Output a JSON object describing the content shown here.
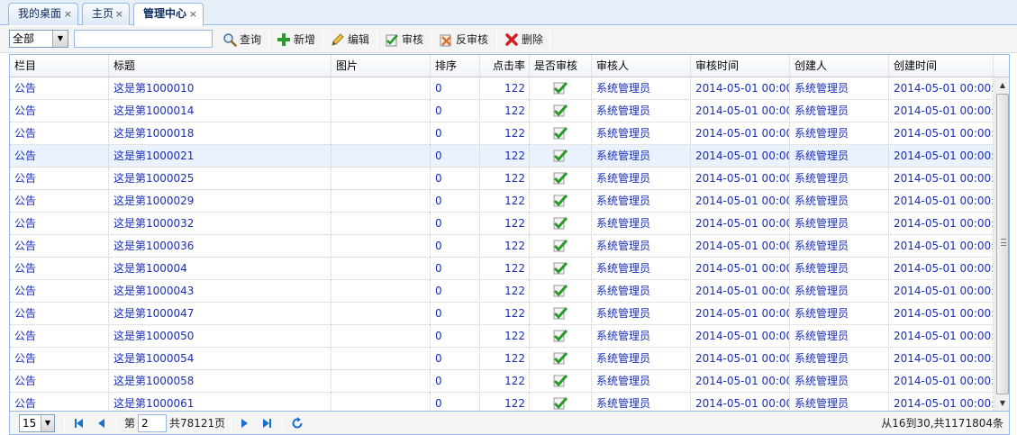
{
  "tabs": [
    {
      "label": "我的桌面",
      "close": "×"
    },
    {
      "label": "主页",
      "close": "×"
    },
    {
      "label": "管理中心",
      "close": "×"
    }
  ],
  "toolbar": {
    "filter_value": "全部",
    "search_value": "",
    "query_label": "查询",
    "add_label": "新增",
    "edit_label": "编辑",
    "audit_label": "审核",
    "unaudit_label": "反审核",
    "delete_label": "删除"
  },
  "grid": {
    "columns": [
      "栏目",
      "标题",
      "图片",
      "排序",
      "点击率",
      "是否审核",
      "审核人",
      "审核时间",
      "创建人",
      "创建时间"
    ],
    "rows": [
      {
        "category": "公告",
        "title": "这是第1000010",
        "image": "",
        "sort": "0",
        "clicks": "122",
        "audited": true,
        "auditor": "系统管理员",
        "audit_time": "2014-05-01 00:00:",
        "creator": "系统管理员",
        "created": "2014-05-01 00:00:0"
      },
      {
        "category": "公告",
        "title": "这是第1000014",
        "image": "",
        "sort": "0",
        "clicks": "122",
        "audited": true,
        "auditor": "系统管理员",
        "audit_time": "2014-05-01 00:00:",
        "creator": "系统管理员",
        "created": "2014-05-01 00:00:0"
      },
      {
        "category": "公告",
        "title": "这是第1000018",
        "image": "",
        "sort": "0",
        "clicks": "122",
        "audited": true,
        "auditor": "系统管理员",
        "audit_time": "2014-05-01 00:00:",
        "creator": "系统管理员",
        "created": "2014-05-01 00:00:0"
      },
      {
        "category": "公告",
        "title": "这是第1000021",
        "image": "",
        "sort": "0",
        "clicks": "122",
        "audited": true,
        "auditor": "系统管理员",
        "audit_time": "2014-05-01 00:00:",
        "creator": "系统管理员",
        "created": "2014-05-01 00:00:0"
      },
      {
        "category": "公告",
        "title": "这是第1000025",
        "image": "",
        "sort": "0",
        "clicks": "122",
        "audited": true,
        "auditor": "系统管理员",
        "audit_time": "2014-05-01 00:00:",
        "creator": "系统管理员",
        "created": "2014-05-01 00:00:0"
      },
      {
        "category": "公告",
        "title": "这是第1000029",
        "image": "",
        "sort": "0",
        "clicks": "122",
        "audited": true,
        "auditor": "系统管理员",
        "audit_time": "2014-05-01 00:00:",
        "creator": "系统管理员",
        "created": "2014-05-01 00:00:0"
      },
      {
        "category": "公告",
        "title": "这是第1000032",
        "image": "",
        "sort": "0",
        "clicks": "122",
        "audited": true,
        "auditor": "系统管理员",
        "audit_time": "2014-05-01 00:00:",
        "creator": "系统管理员",
        "created": "2014-05-01 00:00:0"
      },
      {
        "category": "公告",
        "title": "这是第1000036",
        "image": "",
        "sort": "0",
        "clicks": "122",
        "audited": true,
        "auditor": "系统管理员",
        "audit_time": "2014-05-01 00:00:",
        "creator": "系统管理员",
        "created": "2014-05-01 00:00:0"
      },
      {
        "category": "公告",
        "title": "这是第100004",
        "image": "",
        "sort": "0",
        "clicks": "122",
        "audited": true,
        "auditor": "系统管理员",
        "audit_time": "2014-05-01 00:00:",
        "creator": "系统管理员",
        "created": "2014-05-01 00:00:0"
      },
      {
        "category": "公告",
        "title": "这是第1000043",
        "image": "",
        "sort": "0",
        "clicks": "122",
        "audited": true,
        "auditor": "系统管理员",
        "audit_time": "2014-05-01 00:00:",
        "creator": "系统管理员",
        "created": "2014-05-01 00:00:0"
      },
      {
        "category": "公告",
        "title": "这是第1000047",
        "image": "",
        "sort": "0",
        "clicks": "122",
        "audited": true,
        "auditor": "系统管理员",
        "audit_time": "2014-05-01 00:00:",
        "creator": "系统管理员",
        "created": "2014-05-01 00:00:0"
      },
      {
        "category": "公告",
        "title": "这是第1000050",
        "image": "",
        "sort": "0",
        "clicks": "122",
        "audited": true,
        "auditor": "系统管理员",
        "audit_time": "2014-05-01 00:00:",
        "creator": "系统管理员",
        "created": "2014-05-01 00:00:0"
      },
      {
        "category": "公告",
        "title": "这是第1000054",
        "image": "",
        "sort": "0",
        "clicks": "122",
        "audited": true,
        "auditor": "系统管理员",
        "audit_time": "2014-05-01 00:00:",
        "creator": "系统管理员",
        "created": "2014-05-01 00:00:0"
      },
      {
        "category": "公告",
        "title": "这是第1000058",
        "image": "",
        "sort": "0",
        "clicks": "122",
        "audited": true,
        "auditor": "系统管理员",
        "audit_time": "2014-05-01 00:00:",
        "creator": "系统管理员",
        "created": "2014-05-01 00:00:0"
      },
      {
        "category": "公告",
        "title": "这是第1000061",
        "image": "",
        "sort": "0",
        "clicks": "122",
        "audited": true,
        "auditor": "系统管理员",
        "audit_time": "2014-05-01 00:00:",
        "creator": "系统管理员",
        "created": "2014-05-01 00:00:0"
      }
    ],
    "highlighted_row": 3
  },
  "pager": {
    "page_size": "15",
    "page_prefix": "第",
    "current_page": "2",
    "page_suffix": "共78121页",
    "info": "从16到30,共1171804条"
  },
  "icons": {
    "query": "magnifier-icon",
    "add": "plus-icon",
    "edit": "pencil-icon",
    "audit": "audit-check-icon",
    "unaudit": "unaudit-icon",
    "delete": "red-x-icon",
    "audited": "green-check-icon"
  },
  "colors": {
    "link": "#1a2eb5",
    "border": "#95b8e7",
    "highlight": "#eaf2ff",
    "add": "#2a9a2a",
    "delete": "#d42020"
  }
}
